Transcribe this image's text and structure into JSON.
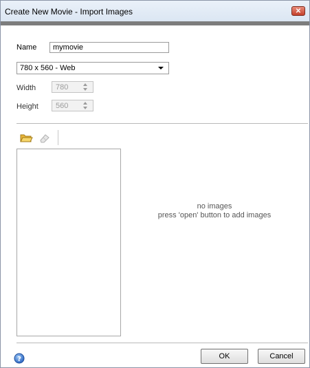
{
  "window": {
    "title": "Create New Movie - Import Images",
    "close_glyph": "✕"
  },
  "form": {
    "name_label": "Name",
    "name_value": "mymovie",
    "size_selected": "780 x 560 - Web",
    "width_label": "Width",
    "width_value": "780",
    "height_label": "Height",
    "height_value": "560"
  },
  "toolbar": {
    "open_icon": "folder-open-icon",
    "clear_icon": "eraser-icon"
  },
  "images": {
    "items": [],
    "empty_line1": "no images",
    "empty_line2": "press 'open' button to add images"
  },
  "footer": {
    "help_icon": "help-icon",
    "ok_label": "OK",
    "cancel_label": "Cancel"
  },
  "colors": {
    "title_bar": "#dbe6f3",
    "close_button": "#c4402b",
    "separator": "#7d7d7d",
    "folder": "#f0c040",
    "help": "#3b78d4"
  }
}
